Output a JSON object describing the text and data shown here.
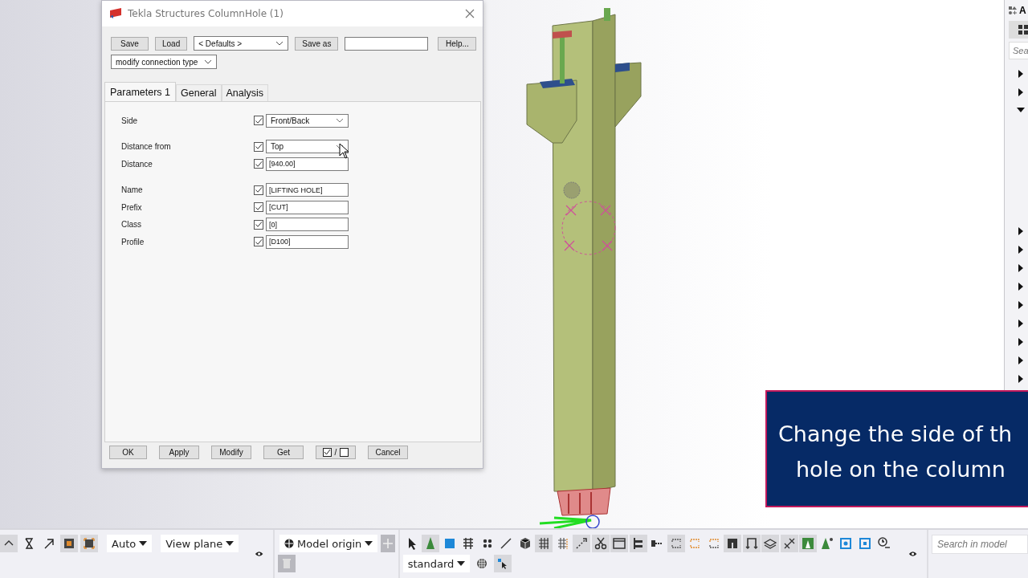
{
  "dialog": {
    "title": "Tekla Structures  ColumnHole (1)",
    "save": "Save",
    "load": "Load",
    "preset": "< Defaults >",
    "save_as": "Save as",
    "help": "Help...",
    "connection_type": "modify connection type",
    "tabs": [
      {
        "label": "Parameters 1",
        "selected": true
      },
      {
        "label": "General",
        "selected": false
      },
      {
        "label": "Analysis",
        "selected": false
      }
    ],
    "param_groups": [
      [
        {
          "label": "Side",
          "kind": "dropdown",
          "checked": true,
          "value": "Front/Back"
        }
      ],
      [
        {
          "label": "Distance from",
          "kind": "dropdown",
          "checked": true,
          "value": "Top"
        },
        {
          "label": "Distance",
          "kind": "input",
          "checked": true,
          "value": "[940.00]"
        }
      ],
      [
        {
          "label": "Name",
          "kind": "input",
          "checked": true,
          "value": "[LIFTING HOLE]"
        },
        {
          "label": "Prefix",
          "kind": "input",
          "checked": true,
          "value": "[CUT]"
        },
        {
          "label": "Class",
          "kind": "input",
          "checked": true,
          "value": "[0]"
        },
        {
          "label": "Profile",
          "kind": "input",
          "checked": true,
          "value": "[D100]"
        }
      ]
    ],
    "buttons": [
      "OK",
      "Apply",
      "Modify",
      "Get"
    ],
    "toggle_separator": "/",
    "cancel": "Cancel"
  },
  "side_panel": {
    "title": "A",
    "search_placeholder": "Sea",
    "tree_nodes": [
      {
        "expanded": false
      },
      {
        "expanded": false
      },
      {
        "expanded": true
      },
      {
        "expanded": false
      },
      {
        "expanded": false
      },
      {
        "expanded": false
      },
      {
        "expanded": false
      },
      {
        "expanded": false
      },
      {
        "expanded": false
      },
      {
        "expanded": false
      },
      {
        "expanded": false
      },
      {
        "expanded": false
      }
    ]
  },
  "caption": {
    "lines": [
      "Change the side of th",
      "hole on the column"
    ]
  },
  "toolbar": {
    "auto": "Auto",
    "view_plane": "View plane",
    "origin": "Model origin",
    "mode": "standard",
    "search_placeholder": "Search in model"
  }
}
